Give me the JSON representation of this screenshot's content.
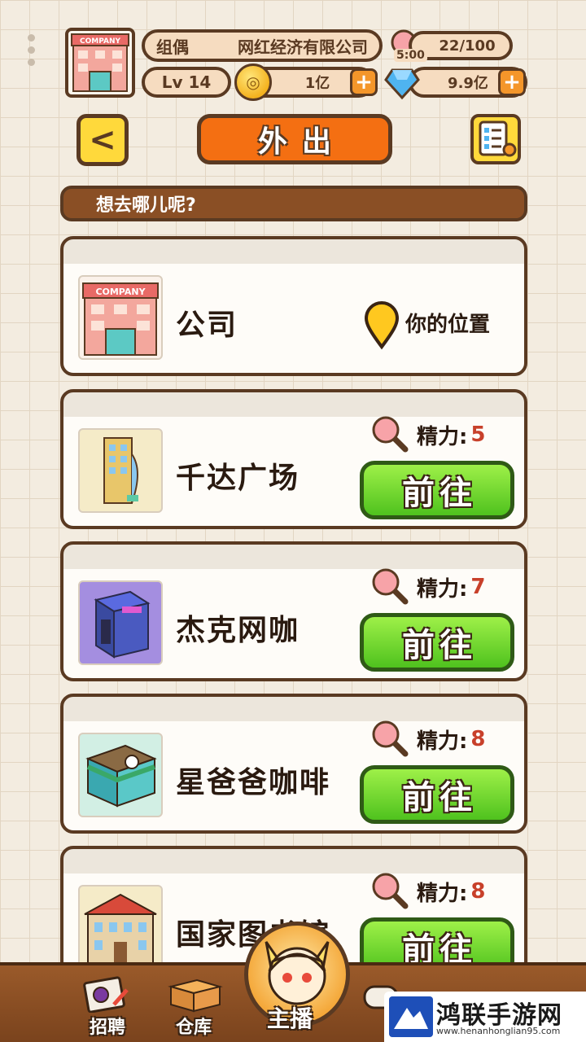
{
  "header": {
    "company_label": "COMPANY",
    "player_title": "组偶",
    "company_name": "网红经济有限公司",
    "level": "Lv 14",
    "coins": "1亿",
    "gems": "9.9亿",
    "energy": "22/100",
    "energy_timer": "5:00"
  },
  "title": {
    "back_label": "<",
    "page_title": "外出"
  },
  "prompt": "想去哪儿呢?",
  "current_location": {
    "name": "公司",
    "thumb_label": "COMPANY",
    "marker_text": "你的位置"
  },
  "locations": [
    {
      "name": "千达广场",
      "energy_label": "精力:",
      "cost": "5",
      "go_label": "前往"
    },
    {
      "name": "杰克网咖",
      "energy_label": "精力:",
      "cost": "7",
      "go_label": "前往"
    },
    {
      "name": "星爸爸咖啡",
      "energy_label": "精力:",
      "cost": "8",
      "go_label": "前往"
    },
    {
      "name": "国家图书馆",
      "energy_label": "精力:",
      "cost": "8",
      "go_label": "前往"
    }
  ],
  "bottom_nav": [
    {
      "label": "招聘"
    },
    {
      "label": "仓库"
    },
    {
      "label": "主播"
    }
  ],
  "watermark": {
    "title": "鸿联手游网",
    "url": "www.henanhonglian95.com"
  },
  "colors": {
    "background": "#f3ece0",
    "title_orange": "#f46f12",
    "go_green": "#4fc21e",
    "prompt_brown": "#8a4f25",
    "nav_brown": "#8a4f25",
    "cost_red": "#c8402a"
  }
}
